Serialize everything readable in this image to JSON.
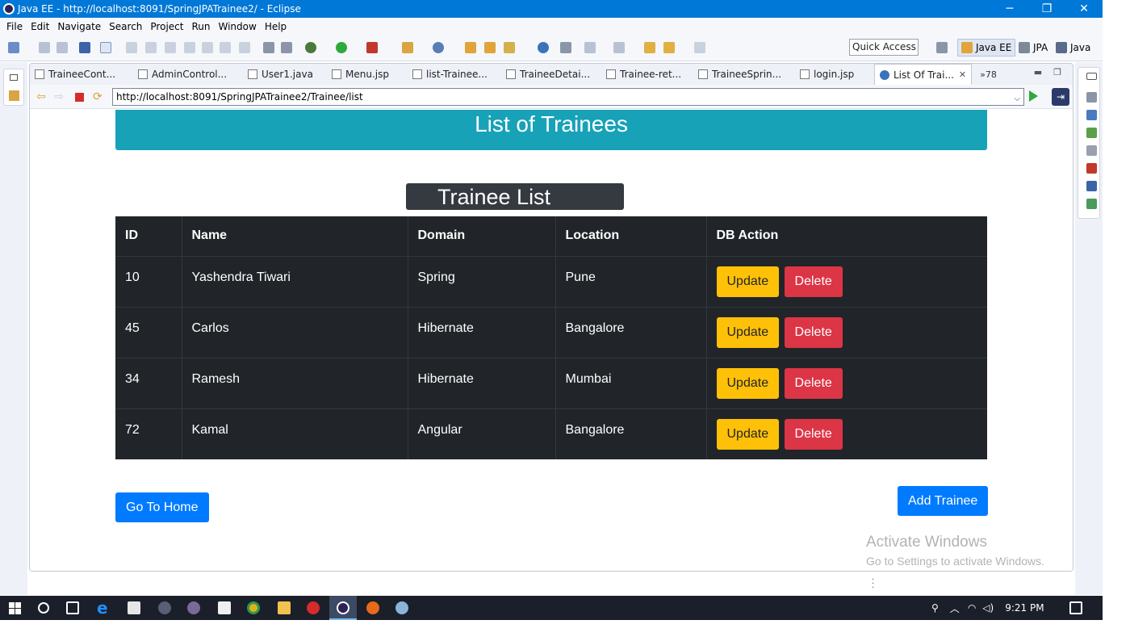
{
  "window": {
    "title": "Java EE - http://localhost:8091/SpringJPATrainee2/ - Eclipse",
    "minimize": "─",
    "restore": "❐",
    "close": "✕"
  },
  "menu": [
    "File",
    "Edit",
    "Navigate",
    "Search",
    "Project",
    "Run",
    "Window",
    "Help"
  ],
  "toolbar": {
    "quick_access": "Quick Access",
    "perspectives": [
      "Java EE",
      "JPA",
      "Java"
    ]
  },
  "tabs": [
    {
      "label": "TraineeCont..."
    },
    {
      "label": "AdminControl..."
    },
    {
      "label": "User1.java"
    },
    {
      "label": "Menu.jsp"
    },
    {
      "label": "list-Trainee..."
    },
    {
      "label": "TraineeDetai..."
    },
    {
      "label": "Trainee-ret..."
    },
    {
      "label": "TraineeSprin..."
    },
    {
      "label": "login.jsp"
    },
    {
      "label": "List Of Trai..."
    }
  ],
  "tab_overflow": "»78",
  "browser": {
    "url": "http://localhost:8091/SpringJPATrainee2/Trainee/list"
  },
  "page": {
    "banner": "List of Trainees",
    "subheading": "Trainee List",
    "columns": [
      "ID",
      "Name",
      "Domain",
      "Location",
      "DB Action"
    ],
    "rows": [
      {
        "id": "10",
        "name": "Yashendra Tiwari",
        "domain": "Spring",
        "location": "Pune"
      },
      {
        "id": "45",
        "name": "Carlos",
        "domain": "Hibernate",
        "location": "Bangalore"
      },
      {
        "id": "34",
        "name": "Ramesh",
        "domain": "Hibernate",
        "location": "Mumbai"
      },
      {
        "id": "72",
        "name": "Kamal",
        "domain": "Angular",
        "location": "Bangalore"
      }
    ],
    "update_label": "Update",
    "delete_label": "Delete",
    "home_button": "Go To Home",
    "add_button": "Add Trainee"
  },
  "watermark": {
    "line1": "Activate Windows",
    "line2": "Go to Settings to activate Windows."
  },
  "taskbar": {
    "time": "9:21 PM"
  },
  "colors": {
    "banner": "#17a2b8",
    "table_bg": "#212529",
    "update": "#ffc107",
    "delete": "#dc3545",
    "primary": "#007bff"
  }
}
